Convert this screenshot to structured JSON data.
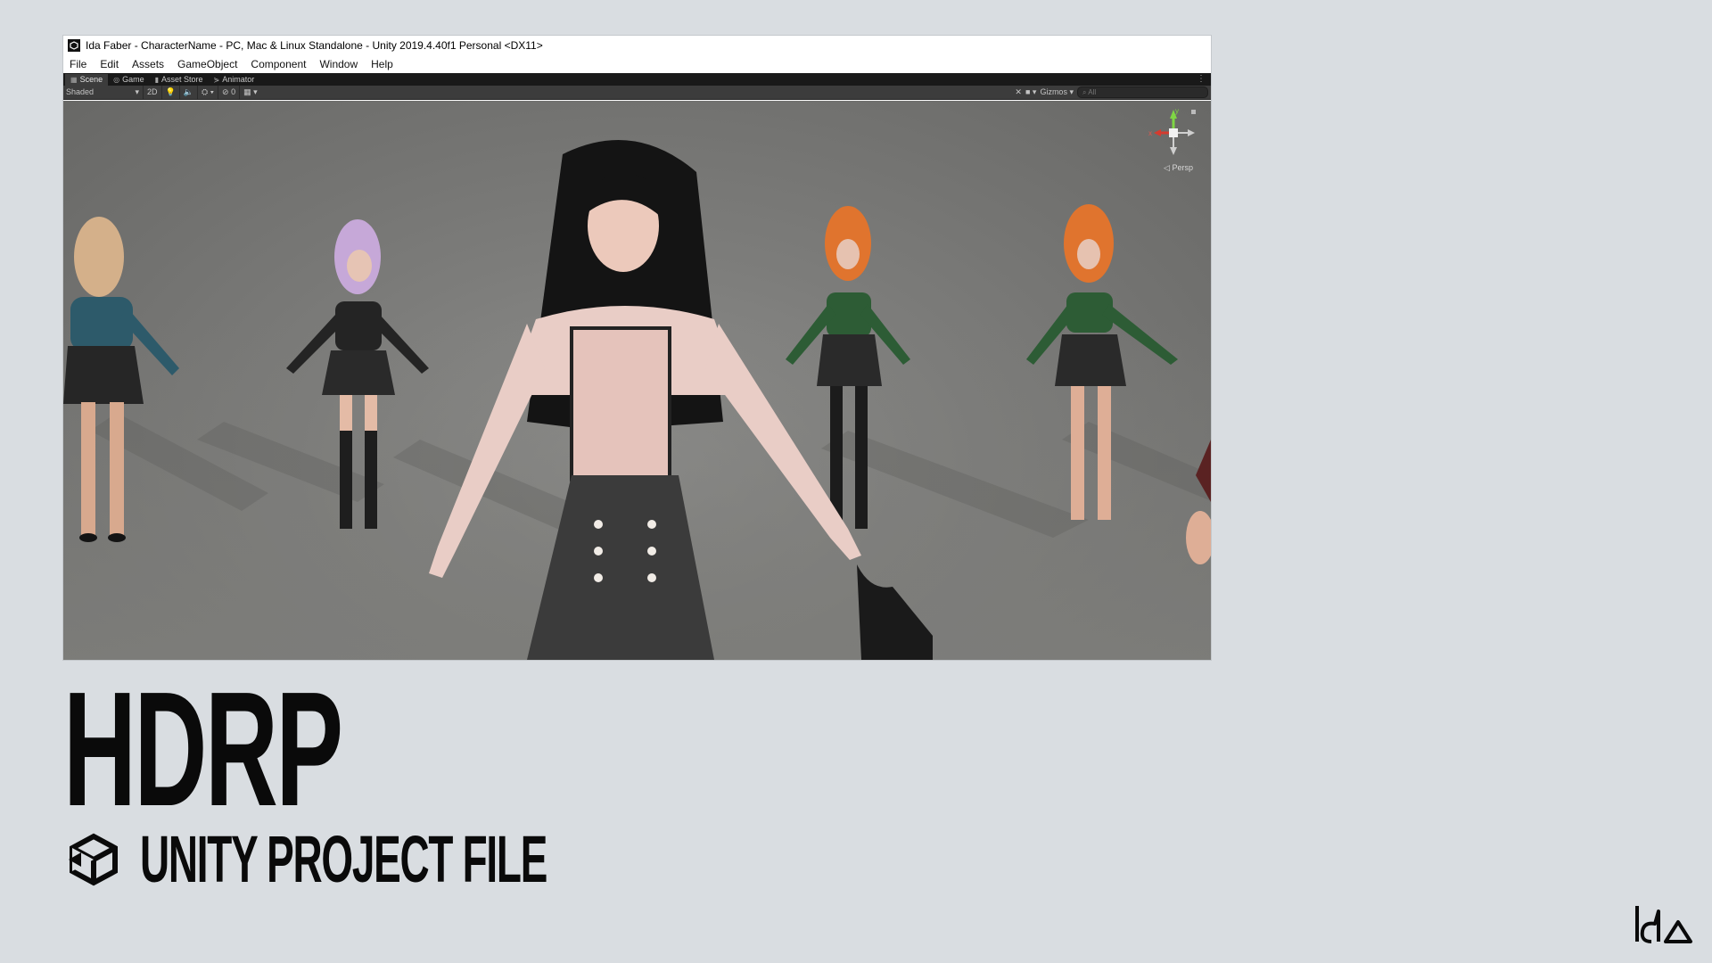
{
  "window": {
    "title": "Ida Faber - CharacterName - PC, Mac & Linux Standalone - Unity 2019.4.40f1 Personal <DX11>"
  },
  "menubar": {
    "items": [
      "File",
      "Edit",
      "Assets",
      "GameObject",
      "Component",
      "Window",
      "Help"
    ]
  },
  "tabs": [
    {
      "label": "Scene",
      "icon": "scene-icon",
      "active": true
    },
    {
      "label": "Game",
      "icon": "game-icon",
      "active": false
    },
    {
      "label": "Asset Store",
      "icon": "asset-store-icon",
      "active": false
    },
    {
      "label": "Animator",
      "icon": "animator-icon",
      "active": false
    }
  ],
  "toolbar": {
    "shading_mode": "Shaded",
    "mode_2d": "2D",
    "hidden_count": "0",
    "gizmos_label": "Gizmos",
    "search_placeholder": "All"
  },
  "viewport": {
    "projection_label": "Persp",
    "axis_x": "x",
    "axis_y": "y"
  },
  "headline": "HDRP",
  "subtitle": "UNITY PROJECT FILE",
  "colors": {
    "page_background": "#d9dde1",
    "editor_dark": "#3c3c3c",
    "tab_bar": "#191919",
    "headline": "#0a0a0a"
  }
}
